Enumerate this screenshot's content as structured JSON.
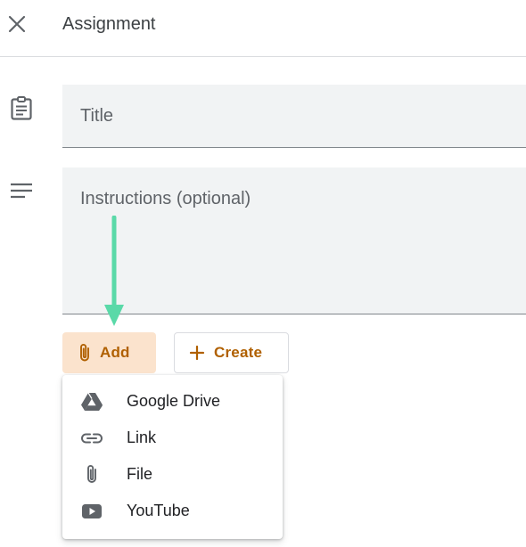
{
  "header": {
    "title": "Assignment"
  },
  "form": {
    "title_placeholder": "Title",
    "instructions_placeholder": "Instructions (optional)"
  },
  "actions": {
    "add_label": "Add",
    "create_label": "Create"
  },
  "add_menu": {
    "items": [
      {
        "label": "Google Drive",
        "icon": "google-drive-icon"
      },
      {
        "label": "Link",
        "icon": "link-icon"
      },
      {
        "label": "File",
        "icon": "paperclip-icon"
      },
      {
        "label": "YouTube",
        "icon": "youtube-icon"
      }
    ]
  },
  "colors": {
    "accent": "#b06000",
    "add_button_bg": "#fbe3cd",
    "field_bg": "#f1f3f4",
    "annotation_arrow": "#5ad9a8"
  }
}
